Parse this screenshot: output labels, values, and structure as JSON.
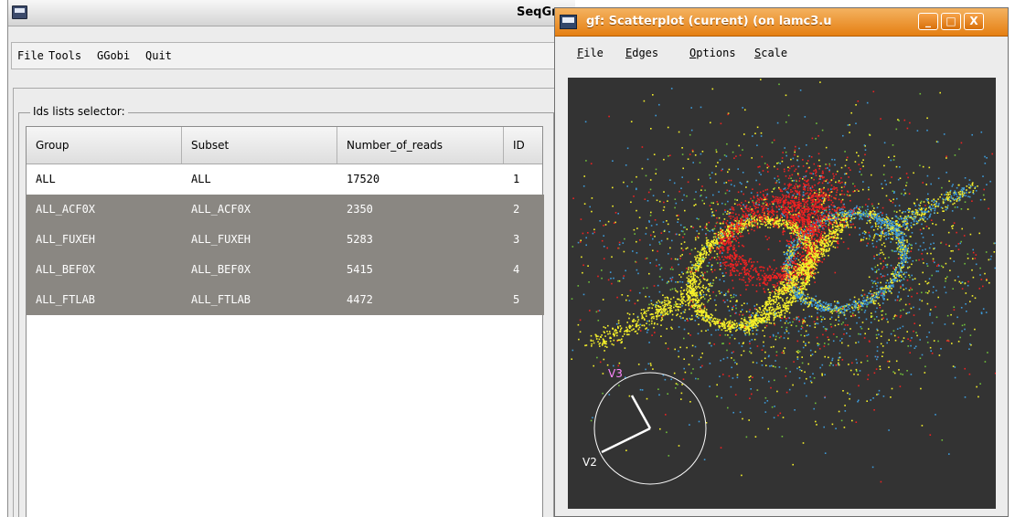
{
  "main_window": {
    "title": "SeqGr",
    "menu": [
      "File",
      "Tools",
      "GGobi",
      "Quit"
    ],
    "group_label": "Ids lists selector:",
    "table": {
      "columns": [
        "Group",
        "Subset",
        "Number_of_reads",
        "ID"
      ],
      "rows": [
        {
          "group": "ALL",
          "subset": "ALL",
          "reads": "17520",
          "id": "1",
          "selected": false
        },
        {
          "group": "ALL_ACF0X",
          "subset": "ALL_ACF0X",
          "reads": "2350",
          "id": "2",
          "selected": true
        },
        {
          "group": "ALL_FUXEH",
          "subset": "ALL_FUXEH",
          "reads": "5283",
          "id": "3",
          "selected": true
        },
        {
          "group": "ALL_BEF0X",
          "subset": "ALL_BEF0X",
          "reads": "5415",
          "id": "4",
          "selected": true
        },
        {
          "group": "ALL_FTLAB",
          "subset": "ALL_FTLAB",
          "reads": "4472",
          "id": "5",
          "selected": true
        }
      ]
    }
  },
  "plot_window": {
    "title": "gf: Scatterplot (current) (on lamc3.u",
    "buttons": {
      "minimize": "_",
      "maximize": "□",
      "close": "X"
    },
    "menu": [
      "File",
      "Edges",
      "Options",
      "Scale"
    ],
    "axes": {
      "v3_label": "V3",
      "v2_label": "V2"
    },
    "colors": {
      "background": "#333333",
      "red": "#ee2222",
      "yellow": "#f5f02a",
      "blue": "#3d9ad8",
      "green": "#6fbf3a",
      "axis_circle": "#ffffff",
      "v3_label": "#ff88ff",
      "v2_label": "#ffffff"
    }
  }
}
